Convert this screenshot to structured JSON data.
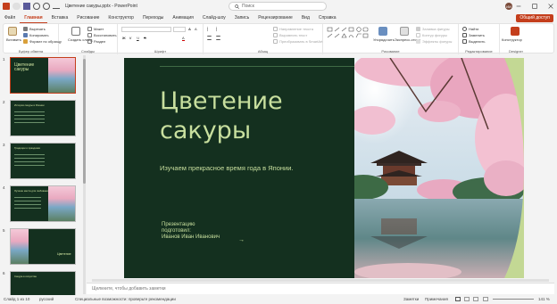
{
  "titlebar": {
    "document_title": "Цветение сакуры.pptx - PowerPoint",
    "search_placeholder": "Поиск",
    "avatar_initials": "ИИ"
  },
  "tabs": [
    "Файл",
    "Главная",
    "Вставка",
    "Рисование",
    "Конструктор",
    "Переходы",
    "Анимация",
    "Слайд-шоу",
    "Запись",
    "Рецензирование",
    "Вид",
    "Справка"
  ],
  "active_tab": "Главная",
  "share_label": "Общий доступ",
  "ribbon": {
    "clipboard": {
      "paste": "Вставить",
      "cut": "Вырезать",
      "copy": "Копировать",
      "format": "Формат по образцу",
      "label": "Буфер обмена"
    },
    "slides": {
      "new_slide": "Создать слайд",
      "layout": "Макет",
      "reset": "Восстановить",
      "section": "Раздел",
      "label": "Слайды"
    },
    "font": {
      "label": "Шрифт"
    },
    "paragraph": {
      "text_direction": "Направление текста",
      "align_text": "Выровнять текст",
      "smartart": "Преобразовать в SmartArt",
      "label": "Абзац"
    },
    "drawing": {
      "arrange": "Упорядочить",
      "quick_styles": "Экспресс-стили",
      "fill": "Заливка фигуры",
      "outline": "Контур фигуры",
      "effects": "Эффекты фигуры",
      "label": "Рисование"
    },
    "editing": {
      "find": "Найти",
      "replace": "Заменить",
      "select": "Выделить",
      "label": "Редактирование"
    },
    "designer": {
      "label": "Designer",
      "button": "Конструктор"
    }
  },
  "thumbnails": [
    {
      "num": "1",
      "title": "Цветение сакуры",
      "selected": true
    },
    {
      "num": "2",
      "title": "История сакуры в Японии",
      "selected": false
    },
    {
      "num": "3",
      "title": "Традиции и праздники",
      "selected": false
    },
    {
      "num": "4",
      "title": "Лучшие места для любования",
      "selected": false
    },
    {
      "num": "5",
      "title": "Цветение",
      "selected": false
    },
    {
      "num": "6",
      "title": "Сакура в искусстве",
      "selected": false
    }
  ],
  "slide": {
    "title_line1": "Цветение",
    "title_line2": "сакуры",
    "subtitle": "Изучаем прекрасное время года в Японии.",
    "author_line1": "Презентацию",
    "author_line2": "подготовил:",
    "author_line3": "Иванов Иван Иванович",
    "arrow": "→"
  },
  "notes_placeholder": "Щелкните, чтобы добавить заметки",
  "status": {
    "slide_counter": "Слайд 1 из 10",
    "language": "русский",
    "accessibility": "Специальные возможности: проверьте рекомендации",
    "notes": "Заметки",
    "comments": "Примечания",
    "zoom": "141 %"
  },
  "colors": {
    "accent": "#c43e1c",
    "slide_bg": "#14301f",
    "slide_text": "#c8df9e"
  }
}
